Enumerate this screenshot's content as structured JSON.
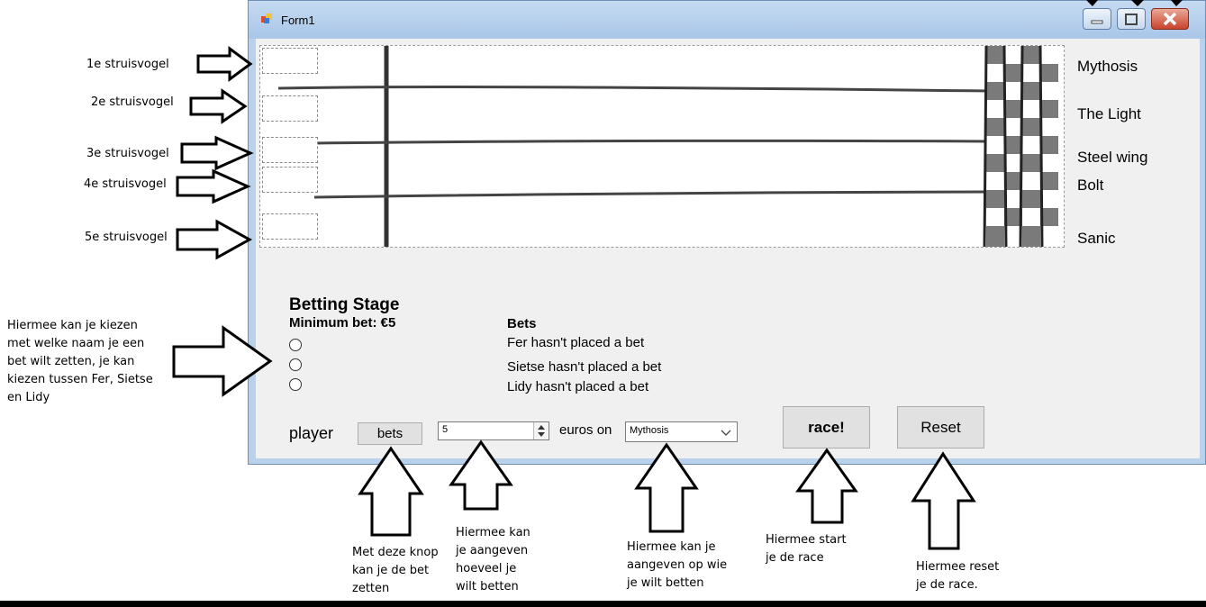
{
  "window": {
    "title": "Form1"
  },
  "race": {
    "horses": [
      "Mythosis",
      "The Light",
      "Steel wing",
      "Bolt",
      "Sanic"
    ]
  },
  "betting": {
    "heading": "Betting Stage",
    "minimum": "Minimum bet: €5",
    "bets_heading": "Bets",
    "bets": [
      "Fer hasn't placed a bet",
      "Sietse hasn't placed a bet",
      "Lidy hasn't placed a bet"
    ]
  },
  "controls": {
    "player_label": "player",
    "bets_button": "bets",
    "amount": "5",
    "euros_on_label": "euros on",
    "selected_horse": "Mythosis",
    "race_button": "race!",
    "reset_button": "Reset"
  },
  "annotations": {
    "ostriches": [
      "1e struisvogel",
      "2e struisvogel",
      "3e struisvogel",
      "4e struisvogel",
      "5e struisvogel"
    ],
    "radio_help": [
      "Hiermee kan je kiezen",
      "met welke naam je een",
      "bet wilt zetten, je kan",
      "kiezen tussen Fer, Sietse",
      "en Lidy"
    ],
    "bets_help": [
      "Met deze knop",
      "kan je de bet",
      "zetten"
    ],
    "amount_help": [
      "Hiermee kan",
      "je aangeven",
      "hoeveel je",
      "wilt betten"
    ],
    "horse_help": [
      "Hiermee kan je",
      "aangeven op wie",
      "je wilt betten"
    ],
    "race_help": [
      "Hiermee start",
      "je de race"
    ],
    "reset_help": [
      "Hiermee reset",
      "je de race."
    ]
  },
  "colors": {
    "titlebar": "#b9d1ea",
    "client": "#f0f0f0",
    "close": "#c9432c",
    "checker": "#7a7a7a"
  }
}
